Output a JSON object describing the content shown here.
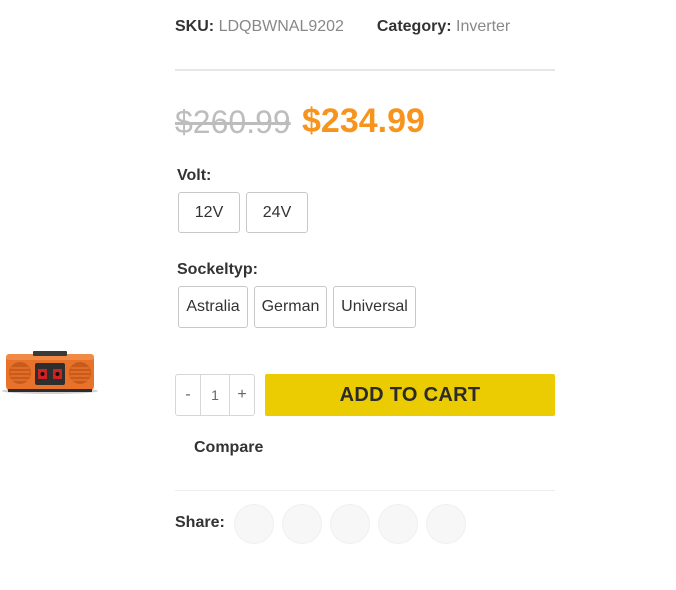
{
  "product": {
    "sku_label": "SKU:",
    "sku_value": "LDQBWNAL9202",
    "category_label": "Category:",
    "category_value": "Inverter"
  },
  "price": {
    "old": "$260.99",
    "current": "$234.99"
  },
  "attributes": {
    "volt": {
      "label": "Volt",
      "options": [
        "12V",
        "24V"
      ]
    },
    "socket": {
      "label": "Sockeltyp",
      "options": [
        "Astralia",
        "German",
        "Universal"
      ]
    }
  },
  "quantity": {
    "minus": "-",
    "value": "1",
    "plus": "+"
  },
  "cart": {
    "button_label": "ADD TO CART"
  },
  "compare": {
    "label": "Compare"
  },
  "share": {
    "label": "Share:",
    "icons": [
      "share-icon-1",
      "share-icon-2",
      "share-icon-3",
      "share-icon-4",
      "share-icon-5"
    ]
  },
  "colors": {
    "accent_price": "#f7941d",
    "cart_button": "#ebcb02"
  }
}
